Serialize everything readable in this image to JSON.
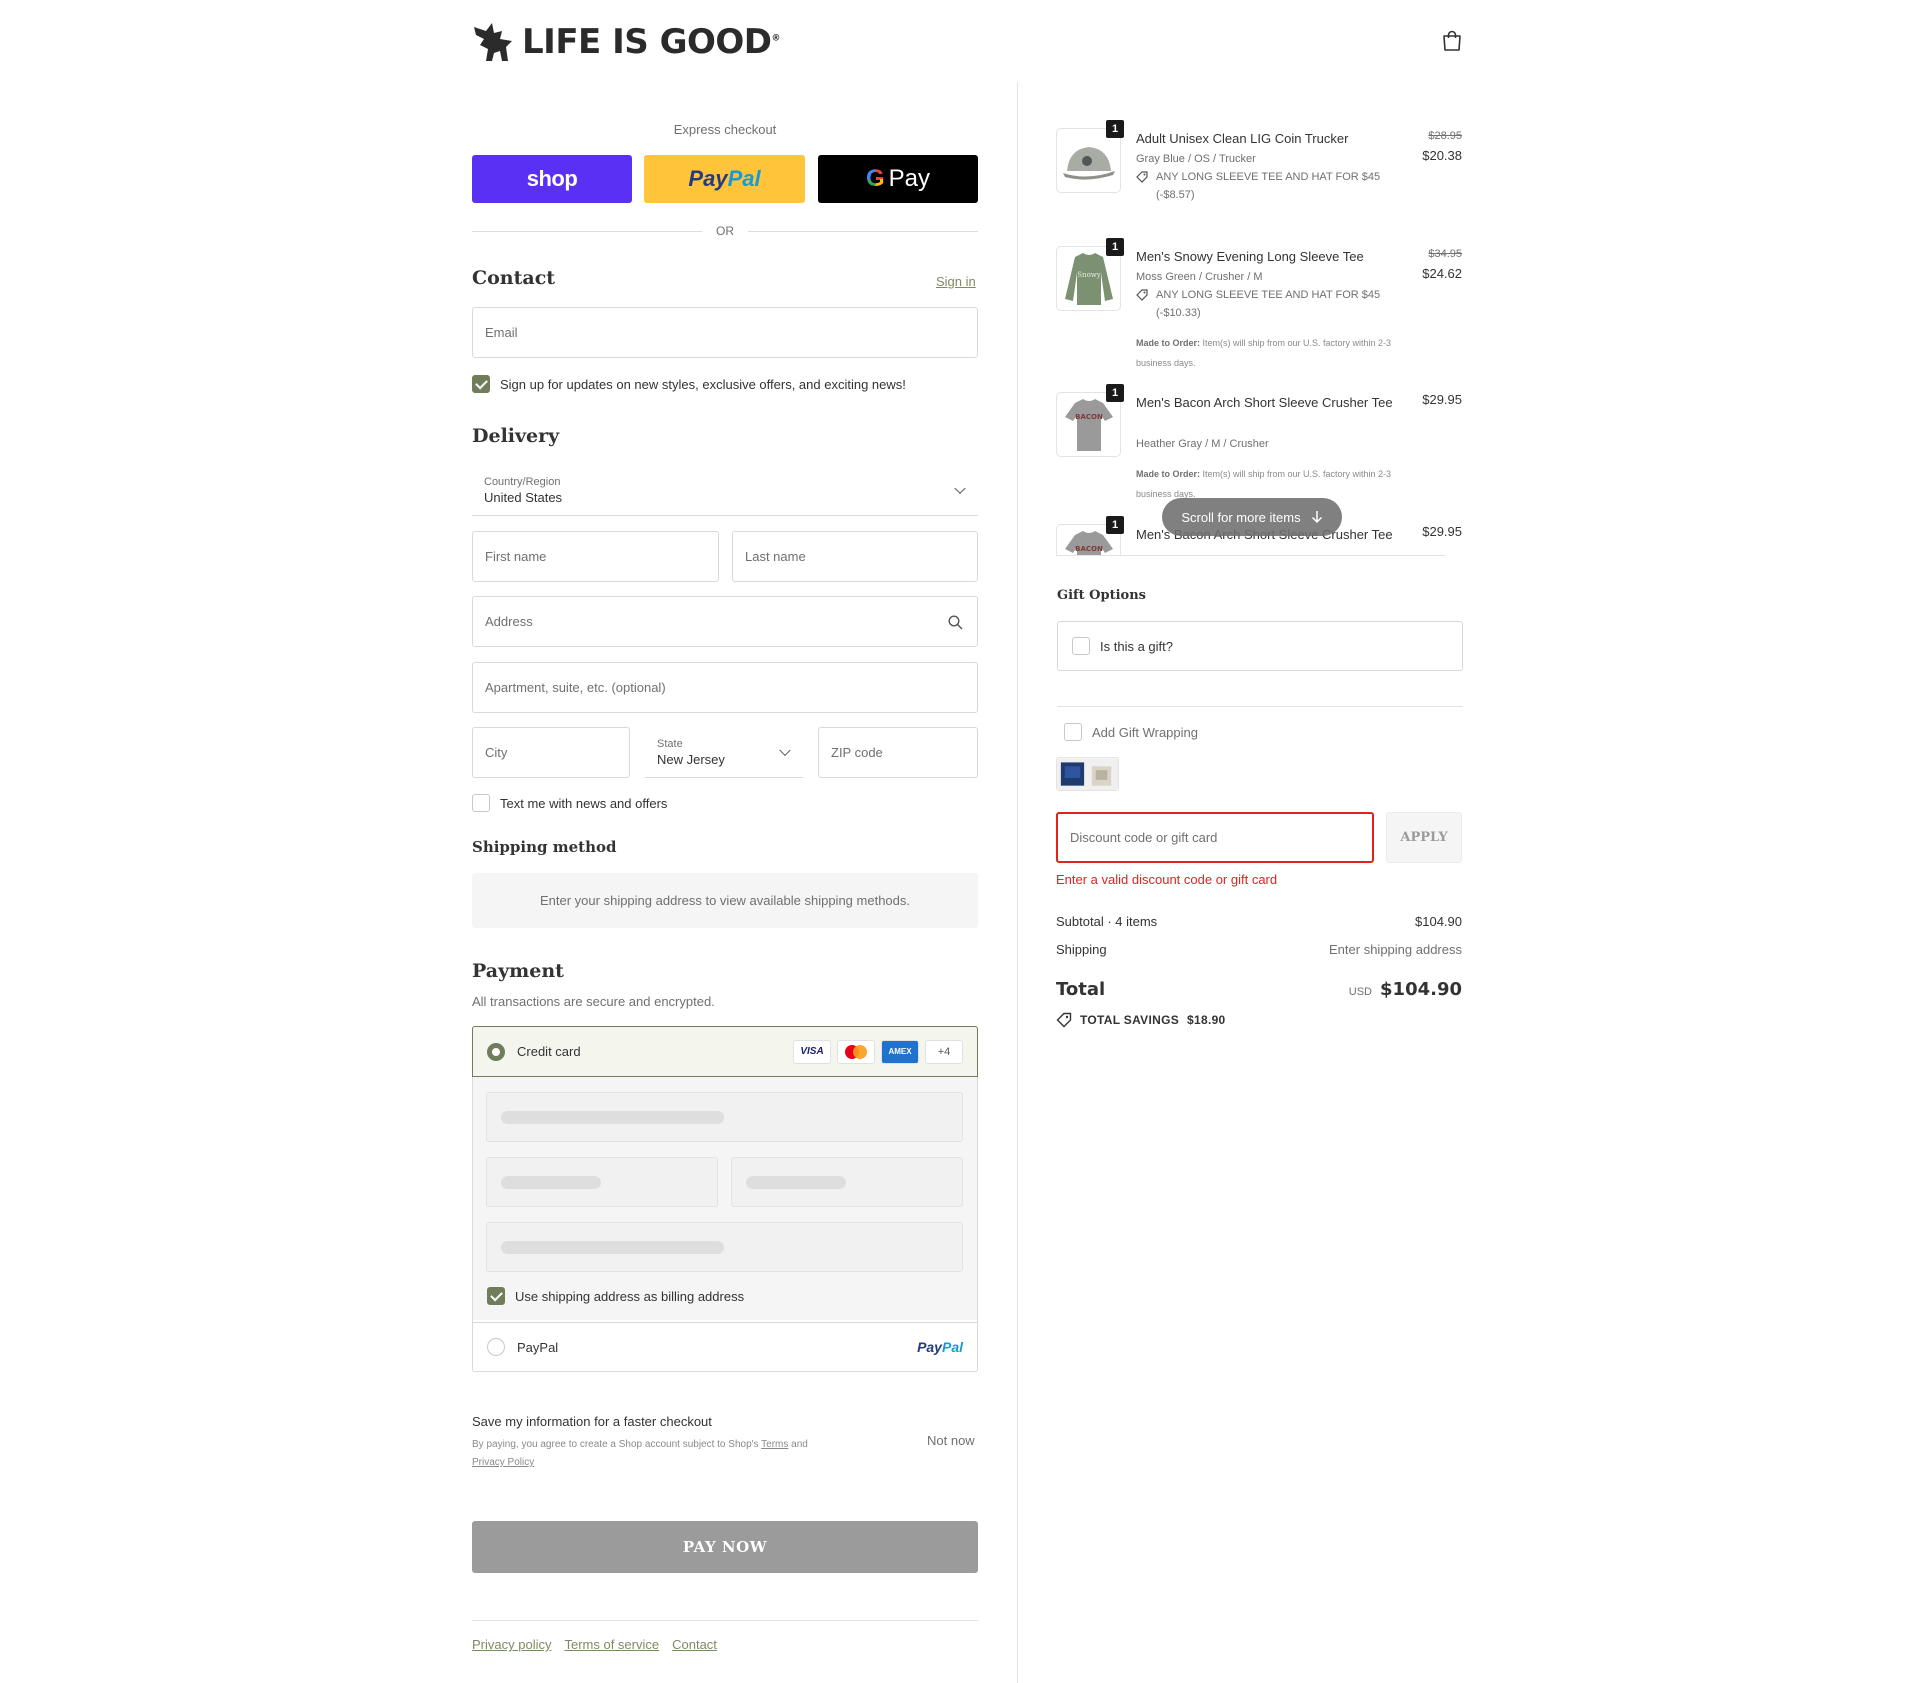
{
  "brand": {
    "name": "LIFE IS GOOD",
    "reg": "®"
  },
  "express": {
    "label": "Express checkout",
    "shop_label": "shop",
    "paypal_label_1": "Pay",
    "paypal_label_2": "Pal",
    "gpay_label": "Pay",
    "or_label": "OR"
  },
  "contact": {
    "title": "Contact",
    "sign_in": "Sign in",
    "email_placeholder": "Email",
    "newsletter_label": "Sign up for updates on new styles, exclusive offers, and exciting news!",
    "newsletter_checked": true
  },
  "delivery": {
    "title": "Delivery",
    "country_label": "Country/Region",
    "country_value": "United States",
    "first_name_placeholder": "First name",
    "last_name_placeholder": "Last name",
    "address_placeholder": "Address",
    "apartment_placeholder": "Apartment, suite, etc. (optional)",
    "city_placeholder": "City",
    "state_label": "State",
    "state_value": "New Jersey",
    "zip_placeholder": "ZIP code",
    "sms_label": "Text me with news and offers"
  },
  "shipping_method": {
    "title": "Shipping method",
    "message": "Enter your shipping address to view available shipping methods."
  },
  "payment": {
    "title": "Payment",
    "subtitle": "All transactions are secure and encrypted.",
    "credit_card_label": "Credit card",
    "cards": [
      "VISA",
      "AMEX",
      "+4"
    ],
    "billing_label": "Use shipping address as billing address",
    "paypal_label": "PayPal",
    "paypal_logo_1": "Pay",
    "paypal_logo_2": "Pal"
  },
  "save_info": {
    "title": "Save my information for a faster checkout",
    "sub_1": "By paying, you agree to create a Shop account subject to Shop's ",
    "terms": "Terms",
    "sub_2": " and ",
    "privacy": "Privacy Policy",
    "not_now": "Not now"
  },
  "pay_now": "PAY NOW",
  "footer": {
    "links": [
      "Privacy policy",
      "Terms of service",
      "Contact"
    ]
  },
  "items": [
    {
      "qty": "1",
      "name": "Adult Unisex Clean LIG Coin Trucker",
      "variant": "Gray Blue / OS / Trucker",
      "discount": "ANY LONG SLEEVE TEE AND HAT FOR $45 (-$8.57)",
      "old_price": "$28.95",
      "price": "$20.38"
    },
    {
      "qty": "1",
      "name": "Men's Snowy Evening Long Sleeve Tee",
      "variant": "Moss Green / Crusher / M",
      "discount": "ANY LONG SLEEVE TEE AND HAT FOR $45 (-$10.33)",
      "old_price": "$34.95",
      "price": "$24.62",
      "note_bold": "Made to Order:",
      "note": " Item(s) will ship from our U.S. factory within 2-3 business days."
    },
    {
      "qty": "1",
      "name": "Men's Bacon Arch Short Sleeve Crusher Tee",
      "variant": "Heather Gray / M / Crusher",
      "price": "$29.95",
      "note_bold": "Made to Order:",
      "note": " Item(s) will ship from our U.S. factory within 2-3 business days."
    },
    {
      "qty": "1",
      "name": "Men's Bacon Arch Short Sleeve Crusher Tee",
      "price": "$29.95"
    }
  ],
  "scroll_hint": "Scroll for more items",
  "gift": {
    "title": "Gift Options",
    "is_gift_label": "Is this a gift?",
    "wrap_label": "Add Gift Wrapping"
  },
  "discount": {
    "placeholder": "Discount code or gift card",
    "apply": "APPLY",
    "error": "Enter a valid discount code or gift card"
  },
  "summary": {
    "subtotal_label": "Subtotal · 4 items",
    "subtotal_value": "$104.90",
    "shipping_label": "Shipping",
    "shipping_value": "Enter shipping address",
    "total_label": "Total",
    "currency": "USD",
    "total_value": "$104.90",
    "savings_label": "TOTAL SAVINGS",
    "savings_value": "$18.90"
  },
  "colors": {
    "accent": "#707c5a",
    "shop": "#5a31f4",
    "paypal": "#ffc439",
    "error": "#e22120"
  }
}
